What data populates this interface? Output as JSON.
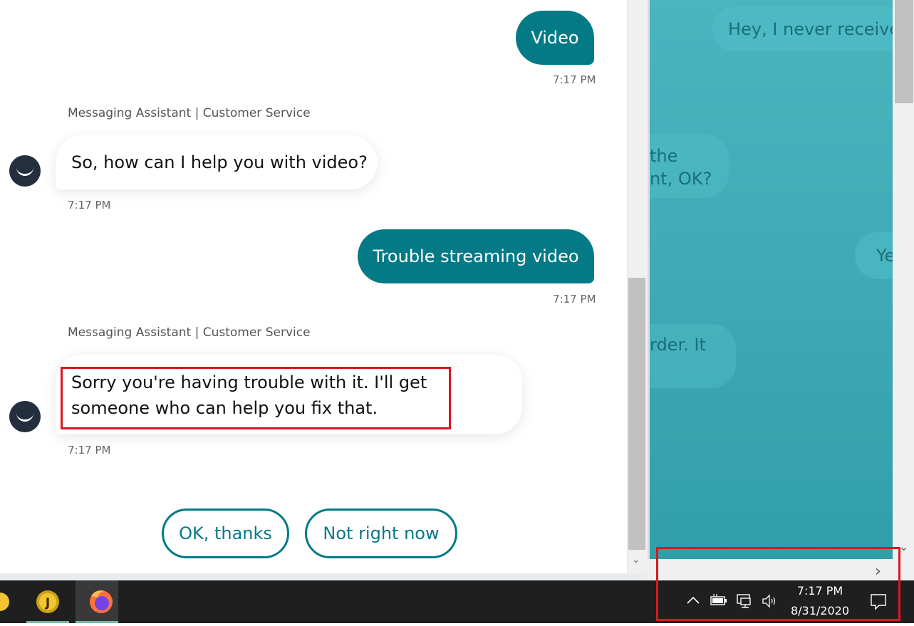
{
  "background_window": {
    "bubbles": [
      "Hey, I never receive",
      "the",
      "nt, OK?",
      "Ye",
      "rder. It"
    ]
  },
  "chat": {
    "messages": [
      {
        "from": "user",
        "text": "Video",
        "time": "7:17 PM"
      },
      {
        "from": "bot",
        "sender": "Messaging Assistant | Customer Service",
        "text": "So, how can I help you with video?",
        "time": "7:17 PM"
      },
      {
        "from": "user",
        "text": "Trouble streaming video",
        "time": "7:17 PM"
      },
      {
        "from": "bot",
        "sender": "Messaging Assistant | Customer Service",
        "text_line1": "Sorry you're having trouble with it. I'll get",
        "text_line2": "someone who can help you fix that.",
        "time": "7:17 PM"
      }
    ],
    "quick_replies": [
      "OK, thanks",
      "Not right now"
    ]
  },
  "taskbar": {
    "apps": [
      "app-icon",
      "j-app-icon",
      "firefox-icon"
    ],
    "tray": {
      "time": "7:17 PM",
      "date": "8/31/2020",
      "icons": [
        "chevron-up-icon",
        "battery-icon",
        "network-icon",
        "volume-icon",
        "notification-icon"
      ]
    }
  },
  "colors": {
    "accent": "#047a87",
    "highlight": "#d71920",
    "taskbar": "#1f1f1f"
  }
}
